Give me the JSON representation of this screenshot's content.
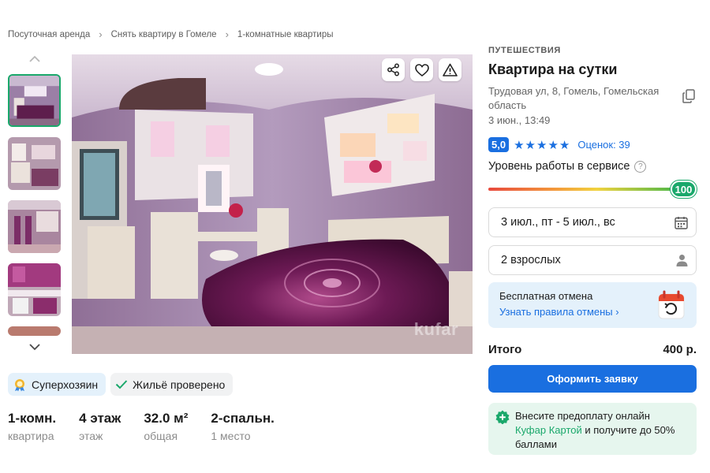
{
  "breadcrumb": {
    "items": [
      "Посуточная аренда",
      "Снять квартиру в Гомеле",
      "1-комнатные квартиры"
    ],
    "separator": "›"
  },
  "gallery": {
    "thumbnail_count": 5,
    "watermark": "kufar"
  },
  "badges": {
    "superhost": "Суперхозяин",
    "verified": "Жильё проверено"
  },
  "specs": [
    {
      "value": "1-комн.",
      "label": "квартира"
    },
    {
      "value": "4 этаж",
      "label": "этаж"
    },
    {
      "value": "32.0 м²",
      "label": "общая"
    },
    {
      "value": "2-спальн.",
      "label": "1 место"
    }
  ],
  "listing": {
    "category": "ПУТЕШЕСТВИЯ",
    "title": "Квартира на сутки",
    "address": "Трудовая ул, 8, Гомель, Гомельская область",
    "date": "3 июн., 13:49"
  },
  "rating": {
    "score": "5,0",
    "stars": 5,
    "reviews_link": "Оценок: 39"
  },
  "service": {
    "label": "Уровень работы в сервисе",
    "help": "?",
    "score": "100",
    "score_value": 100
  },
  "booking": {
    "dates": "3 июл., пт - 5 июл., вс",
    "guests": "2 взрослых",
    "cancel_title": "Бесплатная отмена",
    "cancel_link": "Узнать правила отмены",
    "total_label": "Итого",
    "total_value": "400 р.",
    "submit": "Оформить заявку"
  },
  "promo": {
    "text_before": "Внесите предоплату онлайн",
    "link": "Куфар Картой",
    "text_after": "и получите до 50% баллами"
  },
  "colors": {
    "accent_blue": "#1a6fe0",
    "accent_green": "#1aa86b",
    "info_bg": "#e4f1fb",
    "promo_bg": "#e6f6ee"
  }
}
